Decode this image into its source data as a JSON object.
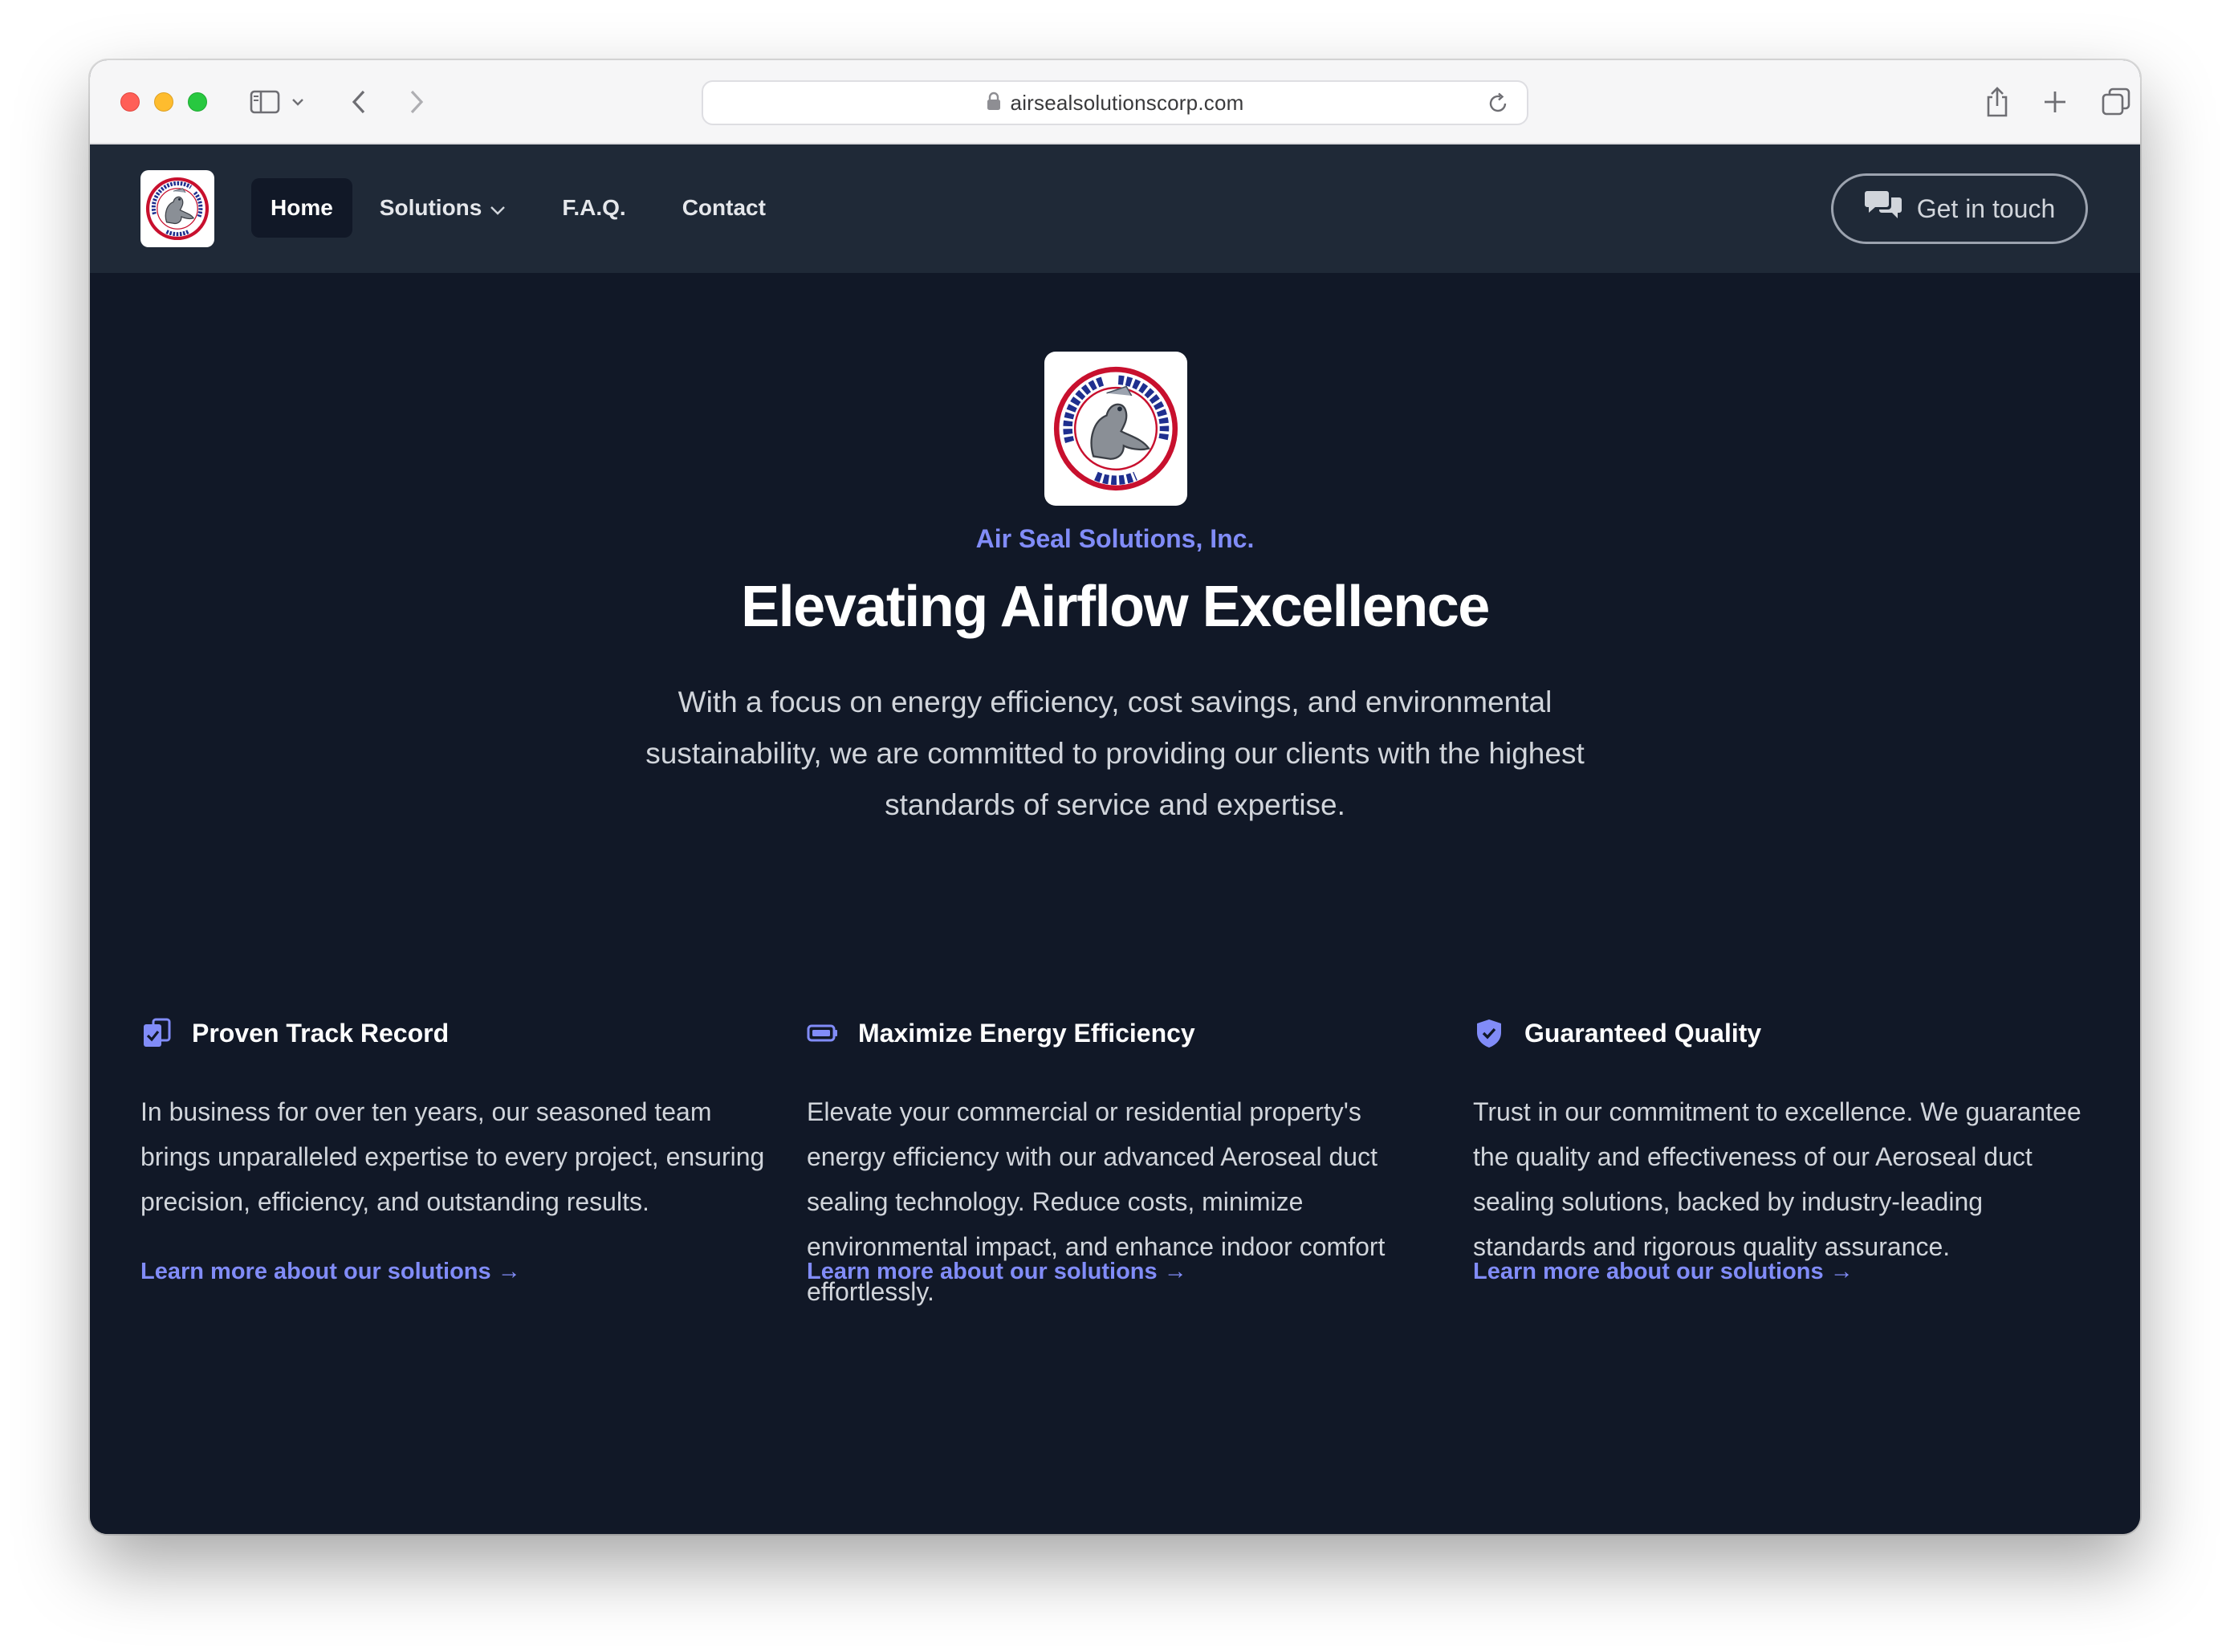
{
  "browser": {
    "url": "airsealsolutionscorp.com"
  },
  "nav": {
    "logo_alt": "Air Seal Solutions Corp",
    "links": [
      {
        "label": "Home"
      },
      {
        "label": "Solutions"
      },
      {
        "label": "F.A.Q."
      },
      {
        "label": "Contact"
      }
    ],
    "cta_label": "Get in touch"
  },
  "logo": {
    "ring_top": "AIR SEAL SOLUTIONS",
    "ring_bottom": "CORP",
    "colors": {
      "ring": "#c8102e",
      "text": "#1f2f8f",
      "seal": "#8a8f96"
    }
  },
  "hero": {
    "eyebrow": "Air Seal Solutions, Inc.",
    "title": "Elevating Airflow Excellence",
    "description": "With a focus on energy efficiency, cost savings, and environmental sustainability, we are committed to providing our clients with the highest standards of service and expertise."
  },
  "features": [
    {
      "icon": "clipboard-check-icon",
      "title": "Proven Track Record",
      "description": "In business for over ten years, our seasoned team brings unparalleled expertise to every project, ensuring precision, efficiency, and outstanding results.",
      "link": "Learn more about our solutions →"
    },
    {
      "icon": "battery-icon",
      "title": "Maximize Energy Efficiency",
      "description": "Elevate your commercial or residential property's energy efficiency with our advanced Aeroseal duct sealing technology. Reduce costs, minimize environmental impact, and enhance indoor comfort effortlessly.",
      "link": "Learn more about our solutions →"
    },
    {
      "icon": "shield-check-icon",
      "title": "Guaranteed Quality",
      "description": "Trust in our commitment to excellence. We guarantee the quality and effectiveness of our Aeroseal duct sealing solutions, backed by industry-leading standards and rigorous quality assurance.",
      "link": "Learn more about our solutions →"
    }
  ],
  "theme": {
    "page_bg": "#111827",
    "navbar_bg": "#1f2937",
    "accent": "#818cf8"
  }
}
